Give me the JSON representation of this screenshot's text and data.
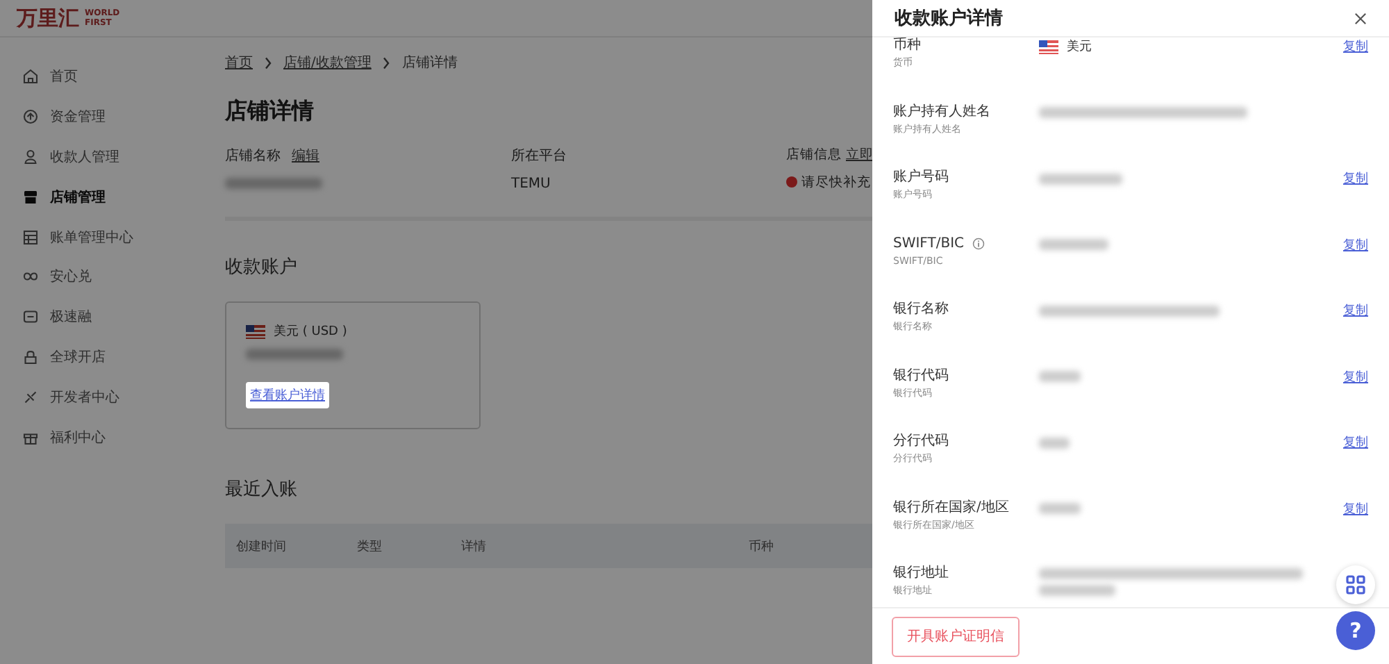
{
  "logo": {
    "name": "万里汇",
    "tagline_1": "WORLD",
    "tagline_2": "FIRST"
  },
  "sidebar": {
    "items": [
      {
        "label": "首页",
        "selected": false
      },
      {
        "label": "资金管理",
        "selected": false
      },
      {
        "label": "收款人管理",
        "selected": false
      },
      {
        "label": "店铺管理",
        "selected": true
      },
      {
        "label": "账单管理中心",
        "selected": false
      },
      {
        "label": "安心兑",
        "selected": false
      },
      {
        "label": "极速融",
        "selected": false
      },
      {
        "label": "全球开店",
        "selected": false
      },
      {
        "label": "开发者中心",
        "selected": false
      },
      {
        "label": "福利中心",
        "selected": false
      }
    ]
  },
  "breadcrumb": [
    "首页",
    "店铺/收款管理",
    "店铺详情"
  ],
  "page_title": "店铺详情",
  "info": [
    {
      "kind": "name",
      "label": "店铺名称",
      "action": "编辑"
    },
    {
      "kind": "text",
      "label": "所在平台",
      "value": "TEMU"
    },
    {
      "kind": "status",
      "label": "店铺信息",
      "action": "立即",
      "status": "请尽快补充"
    }
  ],
  "accounts_title": "收款账户",
  "account_card": {
    "currency": "美元 ( USD )",
    "link": "查看账户详情"
  },
  "recent_title": "最近入账",
  "table": {
    "columns": [
      "创建时间",
      "类型",
      "详情",
      "币种"
    ]
  },
  "drawer": {
    "title": "收款账户详情",
    "rows": [
      {
        "label": "币种",
        "sublabel": "货币",
        "kind": "currency",
        "value": "美元",
        "copy": "复制"
      },
      {
        "label": "账户持有人姓名",
        "sublabel": "账户持有人姓名",
        "kind": "redacted"
      },
      {
        "label": "账户号码",
        "sublabel": "账户号码",
        "kind": "redacted",
        "copy": "复制"
      },
      {
        "label": "SWIFT/BIC",
        "sublabel": "SWIFT/BIC",
        "kind": "redacted",
        "copy": "复制",
        "info": true
      },
      {
        "label": "银行名称",
        "sublabel": "银行名称",
        "kind": "redacted",
        "copy": "复制"
      },
      {
        "label": "银行代码",
        "sublabel": "银行代码",
        "kind": "redacted",
        "copy": "复制"
      },
      {
        "label": "分行代码",
        "sublabel": "分行代码",
        "kind": "redacted",
        "copy": "复制"
      },
      {
        "label": "银行所在国家/地区",
        "sublabel": "银行所在国家/地区",
        "kind": "redacted",
        "copy": "复制"
      },
      {
        "label": "银行地址",
        "sublabel": "银行地址",
        "kind": "redacted2"
      }
    ],
    "footer_button": "开具账户证明信"
  },
  "help_button": "?"
}
